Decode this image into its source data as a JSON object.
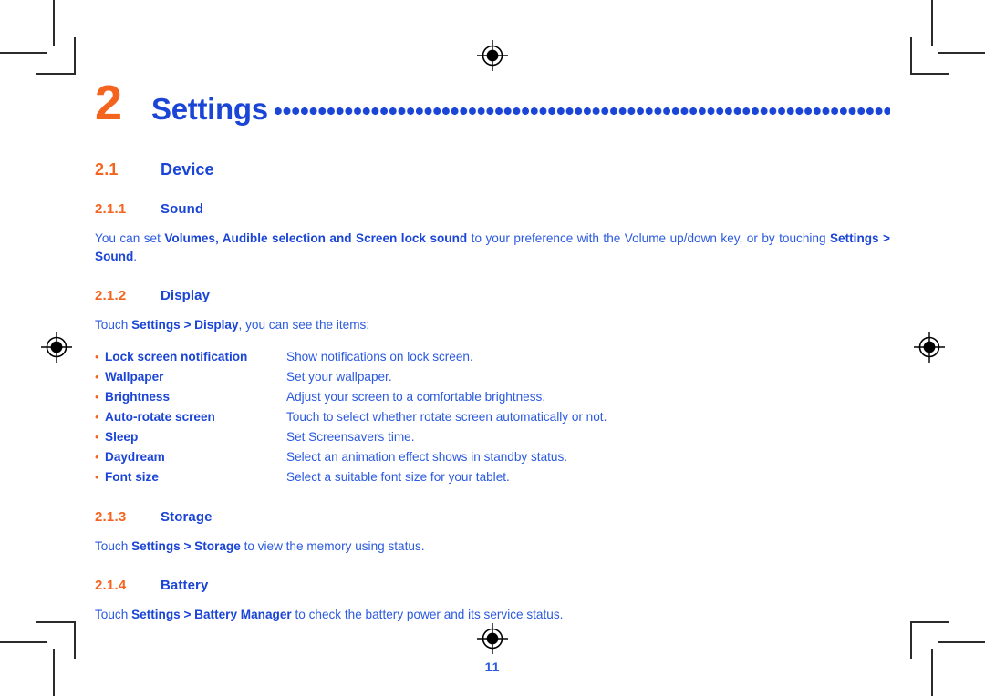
{
  "document": {
    "page_number": "11",
    "colors": {
      "accent_orange": "#f4641e",
      "heading_blue": "#1a45d6",
      "body_blue": "#2b5ae0"
    }
  },
  "chapter": {
    "number": "2",
    "title": "Settings",
    "leader": "dotted-leader"
  },
  "sections": {
    "device": {
      "number": "2.1",
      "title": "Device"
    },
    "sound": {
      "number": "2.1.1",
      "title": "Sound",
      "paragraph": {
        "part1": "You can set ",
        "bold1": "Volumes, Audible selection and Screen lock sound",
        "part2": " to your preference with the Volume up/down key, or by touching ",
        "bold2": "Settings > Sound",
        "part3": "."
      }
    },
    "display": {
      "number": "2.1.2",
      "title": "Display",
      "paragraph": {
        "part1": "Touch ",
        "bold1": "Settings > Display",
        "part2": ", you can see the items:"
      },
      "items": [
        {
          "bullet": "•",
          "term": "Lock screen notification",
          "desc": "Show notifications on lock screen."
        },
        {
          "bullet": "•",
          "term": "Wallpaper",
          "desc": "Set your wallpaper."
        },
        {
          "bullet": "•",
          "term": "Brightness",
          "desc": "Adjust your screen to a comfortable brightness."
        },
        {
          "bullet": "•",
          "term": "Auto-rotate screen",
          "desc": "Touch to select whether rotate screen automatically or not."
        },
        {
          "bullet": "•",
          "term": "Sleep",
          "desc": "Set Screensavers time."
        },
        {
          "bullet": "•",
          "term": "Daydream",
          "desc": "Select an animation effect shows in standby status."
        },
        {
          "bullet": "•",
          "term": "Font size",
          "desc": "Select a suitable font size for your tablet."
        }
      ]
    },
    "storage": {
      "number": "2.1.3",
      "title": "Storage",
      "paragraph": {
        "part1": "Touch ",
        "bold1": "Settings > Storage",
        "part2": " to view the memory using status."
      }
    },
    "battery": {
      "number": "2.1.4",
      "title": "Battery",
      "paragraph": {
        "part1": "Touch ",
        "bold1": "Settings > Battery Manager",
        "part2": " to check the battery power and its service status."
      }
    }
  },
  "print_marks": {
    "registration_top": "registration-target",
    "registration_left": "registration-target",
    "registration_right": "registration-target",
    "registration_bottom": "registration-target",
    "corner_marks": "crop-marks"
  }
}
